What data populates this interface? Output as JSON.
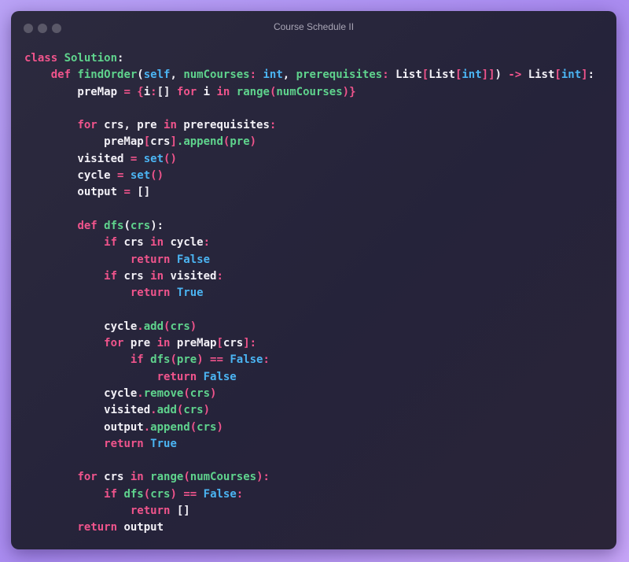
{
  "window": {
    "title": "Course Schedule II"
  },
  "colors": {
    "keyword": "#f0548c",
    "function": "#5fd38d",
    "builtin": "#4bb4f2",
    "text": "#f3f1f7",
    "background": "#27253a"
  },
  "code_lines": [
    [
      [
        "kw",
        "class "
      ],
      [
        "fn",
        "Solution"
      ],
      [
        "va",
        ":"
      ]
    ],
    [
      [
        "va",
        "    "
      ],
      [
        "kw",
        "def "
      ],
      [
        "fn",
        "findOrder"
      ],
      [
        "va",
        "("
      ],
      [
        "bi",
        "self"
      ],
      [
        "va",
        ", "
      ],
      [
        "fn",
        "numCourses"
      ],
      [
        "kw",
        ": "
      ],
      [
        "bi",
        "int"
      ],
      [
        "va",
        ", "
      ],
      [
        "fn",
        "prerequisites"
      ],
      [
        "kw",
        ": "
      ],
      [
        "va",
        "List"
      ],
      [
        "kw",
        "["
      ],
      [
        "va",
        "List"
      ],
      [
        "kw",
        "["
      ],
      [
        "bi",
        "int"
      ],
      [
        "kw",
        "]]"
      ],
      [
        "va",
        ") "
      ],
      [
        "kw",
        "-> "
      ],
      [
        "va",
        "List"
      ],
      [
        "kw",
        "["
      ],
      [
        "bi",
        "int"
      ],
      [
        "kw",
        "]"
      ],
      [
        "va",
        ":"
      ]
    ],
    [
      [
        "va",
        "        preMap "
      ],
      [
        "kw",
        "= "
      ],
      [
        "kw",
        "{"
      ],
      [
        "va",
        "i"
      ],
      [
        "kw",
        ":"
      ],
      [
        "va",
        "[] "
      ],
      [
        "kw",
        "for "
      ],
      [
        "va",
        "i "
      ],
      [
        "kw",
        "in "
      ],
      [
        "fn",
        "range"
      ],
      [
        "kw",
        "("
      ],
      [
        "fn",
        "numCourses"
      ],
      [
        "kw",
        ")}"
      ]
    ],
    [],
    [
      [
        "va",
        "        "
      ],
      [
        "kw",
        "for "
      ],
      [
        "va",
        "crs, pre "
      ],
      [
        "kw",
        "in "
      ],
      [
        "va",
        "prerequisites"
      ],
      [
        "kw",
        ":"
      ]
    ],
    [
      [
        "va",
        "            preMap"
      ],
      [
        "kw",
        "["
      ],
      [
        "va",
        "crs"
      ],
      [
        "kw",
        "]"
      ],
      [
        "fn",
        ".append"
      ],
      [
        "kw",
        "("
      ],
      [
        "fn",
        "pre"
      ],
      [
        "kw",
        ")"
      ]
    ],
    [
      [
        "va",
        "        visited "
      ],
      [
        "kw",
        "= "
      ],
      [
        "bi",
        "set"
      ],
      [
        "kw",
        "()"
      ]
    ],
    [
      [
        "va",
        "        cycle "
      ],
      [
        "kw",
        "= "
      ],
      [
        "bi",
        "set"
      ],
      [
        "kw",
        "()"
      ]
    ],
    [
      [
        "va",
        "        output "
      ],
      [
        "kw",
        "= "
      ],
      [
        "va",
        "[]"
      ]
    ],
    [],
    [
      [
        "va",
        "        "
      ],
      [
        "kw",
        "def "
      ],
      [
        "fn",
        "dfs"
      ],
      [
        "va",
        "("
      ],
      [
        "fn",
        "crs"
      ],
      [
        "va",
        "):"
      ]
    ],
    [
      [
        "va",
        "            "
      ],
      [
        "kw",
        "if "
      ],
      [
        "va",
        "crs "
      ],
      [
        "kw",
        "in "
      ],
      [
        "va",
        "cycle"
      ],
      [
        "kw",
        ":"
      ]
    ],
    [
      [
        "va",
        "                "
      ],
      [
        "kw",
        "return "
      ],
      [
        "bi",
        "False"
      ]
    ],
    [
      [
        "va",
        "            "
      ],
      [
        "kw",
        "if "
      ],
      [
        "va",
        "crs "
      ],
      [
        "kw",
        "in "
      ],
      [
        "va",
        "visited"
      ],
      [
        "kw",
        ":"
      ]
    ],
    [
      [
        "va",
        "                "
      ],
      [
        "kw",
        "return "
      ],
      [
        "bi",
        "True"
      ]
    ],
    [],
    [
      [
        "va",
        "            cycle"
      ],
      [
        "kw",
        "."
      ],
      [
        "fn",
        "add"
      ],
      [
        "kw",
        "("
      ],
      [
        "fn",
        "crs"
      ],
      [
        "kw",
        ")"
      ]
    ],
    [
      [
        "va",
        "            "
      ],
      [
        "kw",
        "for "
      ],
      [
        "va",
        "pre "
      ],
      [
        "kw",
        "in "
      ],
      [
        "va",
        "preMap"
      ],
      [
        "kw",
        "["
      ],
      [
        "va",
        "crs"
      ],
      [
        "kw",
        "]:"
      ]
    ],
    [
      [
        "va",
        "                "
      ],
      [
        "kw",
        "if "
      ],
      [
        "fn",
        "dfs"
      ],
      [
        "kw",
        "("
      ],
      [
        "fn",
        "pre"
      ],
      [
        "kw",
        ") "
      ],
      [
        "kw",
        "== "
      ],
      [
        "bi",
        "False"
      ],
      [
        "kw",
        ":"
      ]
    ],
    [
      [
        "va",
        "                    "
      ],
      [
        "kw",
        "return "
      ],
      [
        "bi",
        "False"
      ]
    ],
    [
      [
        "va",
        "            cycle"
      ],
      [
        "kw",
        "."
      ],
      [
        "fn",
        "remove"
      ],
      [
        "kw",
        "("
      ],
      [
        "fn",
        "crs"
      ],
      [
        "kw",
        ")"
      ]
    ],
    [
      [
        "va",
        "            visited"
      ],
      [
        "kw",
        "."
      ],
      [
        "fn",
        "add"
      ],
      [
        "kw",
        "("
      ],
      [
        "fn",
        "crs"
      ],
      [
        "kw",
        ")"
      ]
    ],
    [
      [
        "va",
        "            output"
      ],
      [
        "kw",
        "."
      ],
      [
        "fn",
        "append"
      ],
      [
        "kw",
        "("
      ],
      [
        "fn",
        "crs"
      ],
      [
        "kw",
        ")"
      ]
    ],
    [
      [
        "va",
        "            "
      ],
      [
        "kw",
        "return "
      ],
      [
        "bi",
        "True"
      ]
    ],
    [],
    [
      [
        "va",
        "        "
      ],
      [
        "kw",
        "for "
      ],
      [
        "va",
        "crs "
      ],
      [
        "kw",
        "in "
      ],
      [
        "fn",
        "range"
      ],
      [
        "kw",
        "("
      ],
      [
        "fn",
        "numCourses"
      ],
      [
        "kw",
        "):"
      ]
    ],
    [
      [
        "va",
        "            "
      ],
      [
        "kw",
        "if "
      ],
      [
        "fn",
        "dfs"
      ],
      [
        "kw",
        "("
      ],
      [
        "fn",
        "crs"
      ],
      [
        "kw",
        ") "
      ],
      [
        "kw",
        "== "
      ],
      [
        "bi",
        "False"
      ],
      [
        "kw",
        ":"
      ]
    ],
    [
      [
        "va",
        "                "
      ],
      [
        "kw",
        "return "
      ],
      [
        "va",
        "[]"
      ]
    ],
    [
      [
        "va",
        "        "
      ],
      [
        "kw",
        "return "
      ],
      [
        "va",
        "output"
      ]
    ]
  ]
}
